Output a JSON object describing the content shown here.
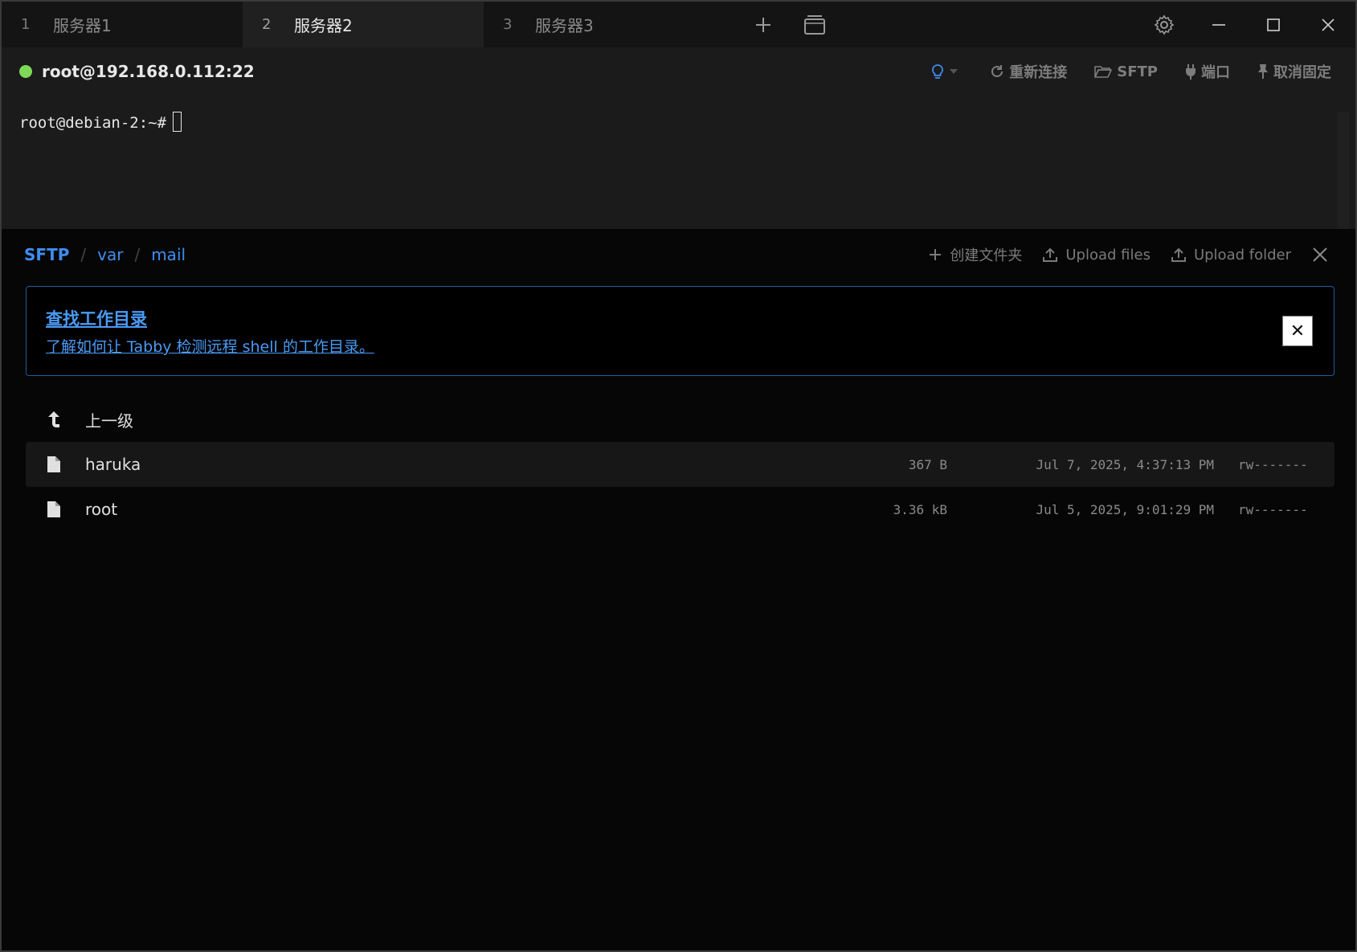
{
  "tabs": [
    {
      "num": "1",
      "label": "服务器1"
    },
    {
      "num": "2",
      "label": "服务器2"
    },
    {
      "num": "3",
      "label": "服务器3"
    }
  ],
  "connection": {
    "host": "root@192.168.0.112:22",
    "status_color": "#7ed957",
    "actions": {
      "reconnect": "重新连接",
      "sftp": "SFTP",
      "ports": "端口",
      "unpin": "取消固定"
    }
  },
  "terminal": {
    "prompt": "root@debian-2:~#"
  },
  "sftp": {
    "breadcrumb": [
      "SFTP",
      "var",
      "mail"
    ],
    "actions": {
      "create_folder": "创建文件夹",
      "upload_files": "Upload files",
      "upload_folder": "Upload folder"
    },
    "notice": {
      "title": "查找工作目录",
      "link": "了解如何让 Tabby 检测远程 shell 的工作目录。",
      "close": "✕"
    },
    "parent_label": "上一级",
    "files": [
      {
        "name": "haruka",
        "size": "367 B",
        "date": "Jul 7, 2025, 4:37:13 PM",
        "perm": "rw-------"
      },
      {
        "name": "root",
        "size": "3.36 kB",
        "date": "Jul 5, 2025, 9:01:29 PM",
        "perm": "rw-------"
      }
    ]
  },
  "colors": {
    "accent": "#3f8ef0",
    "status_ok": "#7ed957"
  }
}
